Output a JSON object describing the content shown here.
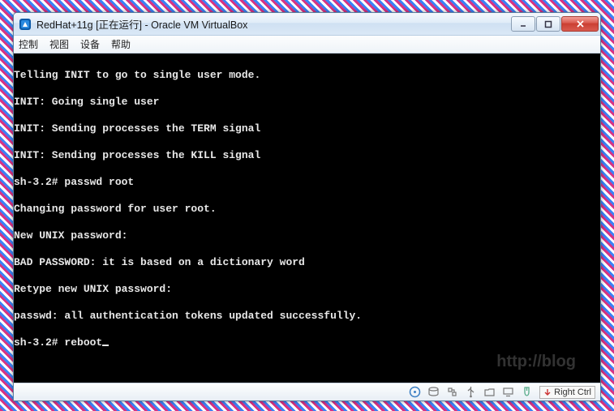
{
  "window": {
    "title": "RedHat+11g [正在运行] - Oracle VM VirtualBox"
  },
  "menu": {
    "items": [
      "控制",
      "视图",
      "设备",
      "帮助"
    ]
  },
  "terminal": {
    "lines": [
      "Telling INIT to go to single user mode.",
      "INIT: Going single user",
      "INIT: Sending processes the TERM signal",
      "INIT: Sending processes the KILL signal",
      "sh-3.2# passwd root",
      "Changing password for user root.",
      "New UNIX password:",
      "BAD PASSWORD: it is based on a dictionary word",
      "Retype new UNIX password:",
      "passwd: all authentication tokens updated successfully.",
      "sh-3.2# reboot"
    ]
  },
  "statusbar": {
    "host_key": "Right Ctrl"
  },
  "watermark": "http://blog"
}
